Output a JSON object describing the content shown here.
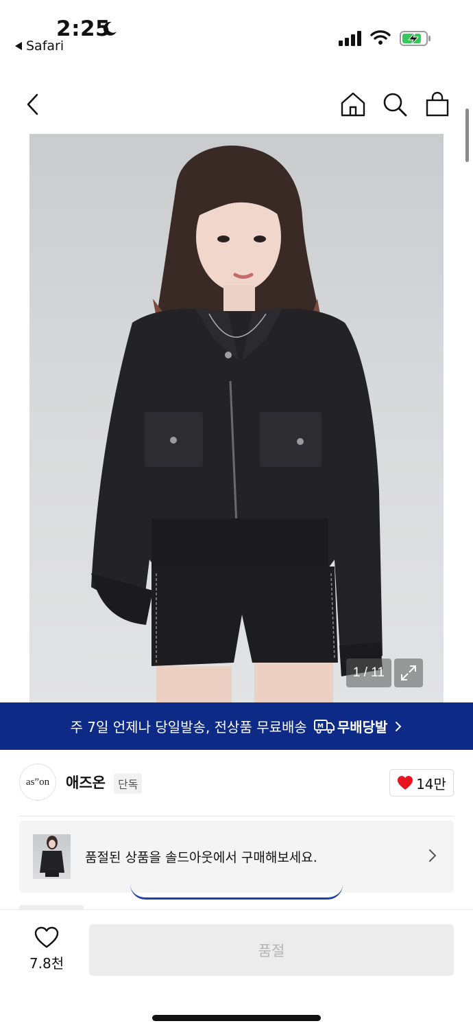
{
  "status_bar": {
    "time": "2:25",
    "back_app": "Safari"
  },
  "product": {
    "image_counter": "1 / 11"
  },
  "banner": {
    "text": "주 7일 언제나 당일발송, 전상품 무료배송",
    "tag": "무배당발",
    "bg_color": "#0d2a86"
  },
  "brand": {
    "logo_text": "as”on",
    "name": "애즈온",
    "badge": "단독",
    "likes": "14만"
  },
  "soldout_card": {
    "text": "품절된 상품을 솔드아웃에서 구매해보세요."
  },
  "bottom_bar": {
    "wish_count": "7.8천",
    "buy_label": "품절"
  },
  "colors": {
    "accent": "#0d2a86",
    "like_heart": "#e8141d",
    "battery_fill": "#34c759"
  }
}
